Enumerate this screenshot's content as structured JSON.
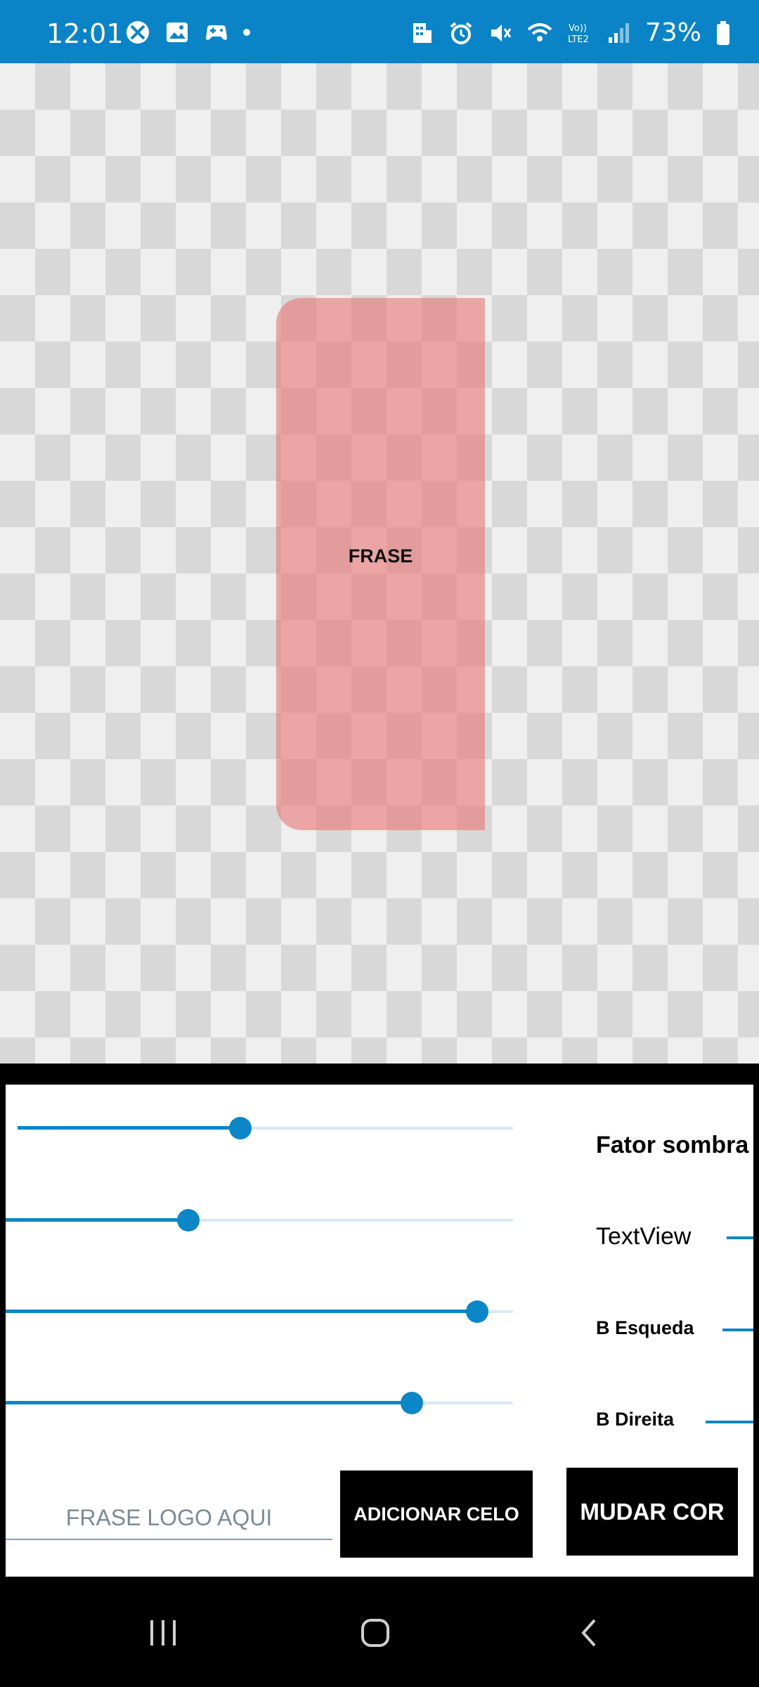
{
  "status_bar": {
    "time": "12:01",
    "battery": "73%",
    "left_icons": [
      "xbox-icon",
      "gallery-icon",
      "game-controller-icon",
      "dot"
    ],
    "right_icons": [
      "building-icon",
      "alarm-icon",
      "mute-icon",
      "wifi-icon",
      "volte-icon",
      "signal-icon",
      "battery-icon"
    ],
    "background": "#0a84c6"
  },
  "canvas": {
    "label": "FRASE",
    "box_color": "#e87878"
  },
  "controls": {
    "sliders": [
      {
        "label": "Fator sombra",
        "value": 0.45
      },
      {
        "label": "TextView",
        "value": 0.36
      },
      {
        "label": "B Esqueda",
        "value": 0.93
      },
      {
        "label": "B Direita",
        "value": 0.8
      }
    ],
    "input_placeholder": "FRASE LOGO AQUI",
    "add_button": "ADICIONAR CELO",
    "color_button": "MUDAR COR",
    "accent": "#0b86c6"
  },
  "nav_bar": {
    "icons": [
      "recent-apps-icon",
      "home-icon",
      "back-icon"
    ]
  }
}
